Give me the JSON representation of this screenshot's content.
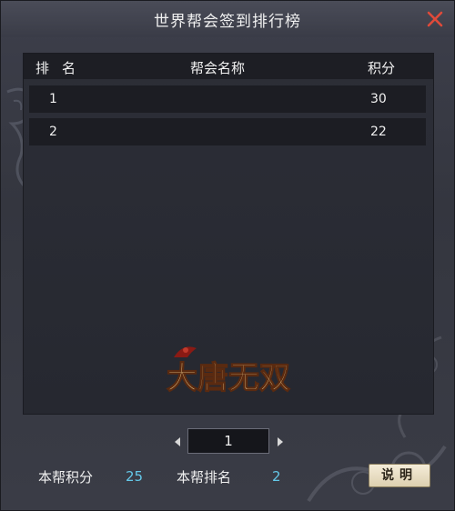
{
  "window": {
    "title": "世界帮会签到排行榜"
  },
  "table": {
    "headers": {
      "rank": "排名",
      "guild_name": "帮会名称",
      "score": "积分"
    },
    "rows": [
      {
        "rank": "1",
        "guild_name": "",
        "score": "30"
      },
      {
        "rank": "2",
        "guild_name": "",
        "score": "22"
      }
    ]
  },
  "logo": {
    "text": "大唐无双"
  },
  "pager": {
    "current_page": "1"
  },
  "footer": {
    "guild_score_label": "本帮积分",
    "guild_score_value": "25",
    "guild_rank_label": "本帮排名",
    "guild_rank_value": "2",
    "explain_button_label": "说明"
  },
  "colors": {
    "accent_value": "#64c8e8",
    "close_icon": "#e04a3a"
  },
  "icons": {
    "close": "close-icon",
    "prev": "triangle-left-icon",
    "next": "triangle-right-icon"
  }
}
